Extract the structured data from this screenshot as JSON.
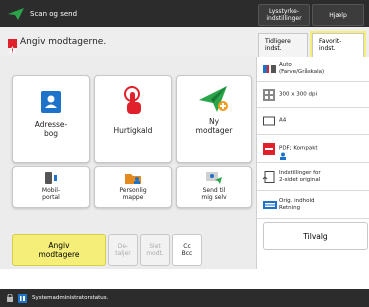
{
  "header": {
    "app_title": "Scan og send",
    "settings_button": "Lysstyrke-\nindstillinger",
    "help_button": "Hjælp"
  },
  "subheader": {
    "title": "Angiv modtagerne.",
    "tab_previous": "Tidligere\nindst.",
    "tab_favorites": "Favorit-\nindst."
  },
  "destinations": [
    {
      "label": "Adresse-\nbog",
      "icon": "address-book-icon"
    },
    {
      "label": "Hurtigkald",
      "icon": "tap-hand-icon"
    },
    {
      "label": "Ny\nmodtager",
      "icon": "paper-plane-plus-icon"
    },
    {
      "label": "Mobil-\nportal",
      "icon": "mobile-device-icon"
    },
    {
      "label": "Personlig\nmappe",
      "icon": "personal-folder-icon"
    },
    {
      "label": "Send til\nmig selv",
      "icon": "send-to-myself-icon"
    }
  ],
  "bottom_buttons": {
    "specify": "Angiv\nmodtagere",
    "details": "De-\ntaljer",
    "delete": "Slet\nmodt.",
    "cc_bcc": "Cc\nBcc"
  },
  "settings": {
    "color_mode": "Auto\n(Farve/Gråskala)",
    "resolution": "300 x 300 dpi",
    "paper": "A4",
    "file_format": "PDF; Kompakt",
    "duplex": "Indstillinger for\n2-sidet original",
    "orientation": "Orig. indhold\nRetning",
    "options_button": "Tilvalg"
  },
  "status_bar": {
    "text": "Systemadministratorstatus."
  },
  "colors": {
    "header_bg": "#2c2c2c",
    "accent_yellow": "#f5ef7a",
    "warning_red": "#e0202a",
    "green": "#2aa54a"
  }
}
